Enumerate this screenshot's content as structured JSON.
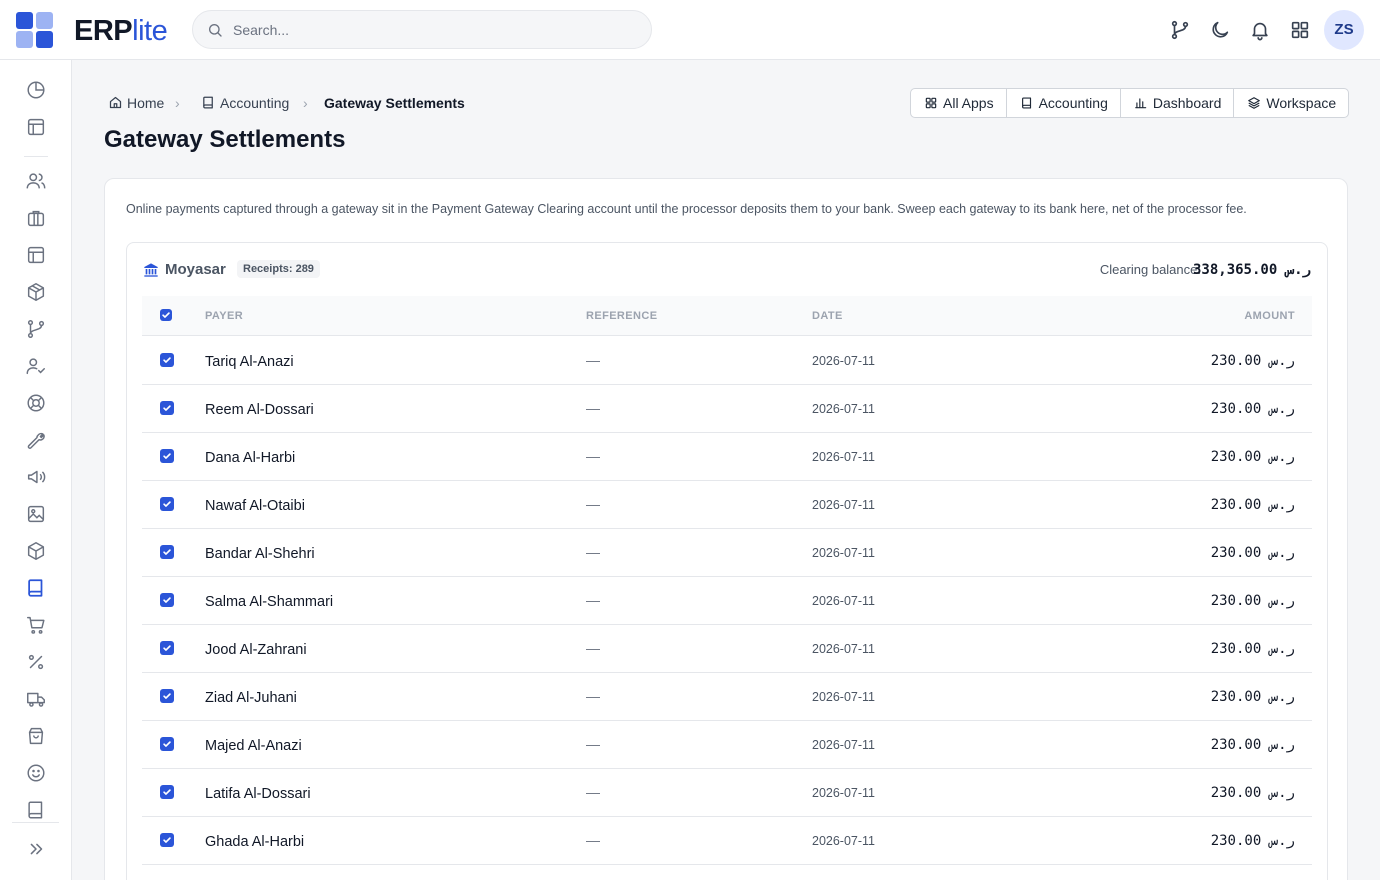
{
  "app": {
    "logo_bold": "ERP",
    "logo_light": "lite"
  },
  "search": {
    "placeholder": "Search..."
  },
  "user": {
    "initials": "ZS"
  },
  "breadcrumb": [
    {
      "label": "Home",
      "icon": "home-icon"
    },
    {
      "label": "Accounting",
      "icon": "book-icon"
    },
    {
      "label": "Gateway Settlements"
    }
  ],
  "quick_links": [
    {
      "label": "All Apps",
      "icon": "grid-icon"
    },
    {
      "label": "Accounting",
      "icon": "book-icon"
    },
    {
      "label": "Dashboard",
      "icon": "bar-chart-icon"
    },
    {
      "label": "Workspace",
      "icon": "layers-icon"
    }
  ],
  "page": {
    "title": "Gateway Settlements",
    "description": "Online payments captured through a gateway sit in the Payment Gateway Clearing account until the processor deposits them to your bank. Sweep each gateway to its bank here, net of the processor fee."
  },
  "gateway": {
    "name": "Moyasar",
    "receipts_badge": "Receipts: 289",
    "balance_label": "Clearing balance:",
    "balance_value": "338,365.00 ر.س",
    "columns": {
      "payer": "PAYER",
      "reference": "REFERENCE",
      "date": "DATE",
      "amount": "AMOUNT"
    },
    "select_all": true,
    "rows": [
      {
        "payer": "Tariq Al-Anazi",
        "reference": "—",
        "date": "2026-07-11",
        "amount": "230.00 ر.س",
        "checked": true
      },
      {
        "payer": "Reem Al-Dossari",
        "reference": "—",
        "date": "2026-07-11",
        "amount": "230.00 ر.س",
        "checked": true
      },
      {
        "payer": "Dana Al-Harbi",
        "reference": "—",
        "date": "2026-07-11",
        "amount": "230.00 ر.س",
        "checked": true
      },
      {
        "payer": "Nawaf Al-Otaibi",
        "reference": "—",
        "date": "2026-07-11",
        "amount": "230.00 ر.س",
        "checked": true
      },
      {
        "payer": "Bandar Al-Shehri",
        "reference": "—",
        "date": "2026-07-11",
        "amount": "230.00 ر.س",
        "checked": true
      },
      {
        "payer": "Salma Al-Shammari",
        "reference": "—",
        "date": "2026-07-11",
        "amount": "230.00 ر.س",
        "checked": true
      },
      {
        "payer": "Jood Al-Zahrani",
        "reference": "—",
        "date": "2026-07-11",
        "amount": "230.00 ر.س",
        "checked": true
      },
      {
        "payer": "Ziad Al-Juhani",
        "reference": "—",
        "date": "2026-07-11",
        "amount": "230.00 ر.س",
        "checked": true
      },
      {
        "payer": "Majed Al-Anazi",
        "reference": "—",
        "date": "2026-07-11",
        "amount": "230.00 ر.س",
        "checked": true
      },
      {
        "payer": "Latifa Al-Dossari",
        "reference": "—",
        "date": "2026-07-11",
        "amount": "230.00 ر.س",
        "checked": true
      },
      {
        "payer": "Ghada Al-Harbi",
        "reference": "—",
        "date": "2026-07-11",
        "amount": "230.00 ر.س",
        "checked": true
      }
    ]
  },
  "sidebar": {
    "items": [
      {
        "icon": "pie-chart-icon"
      },
      {
        "icon": "layout-icon"
      },
      {
        "icon": "users-icon"
      },
      {
        "icon": "briefcase-icon"
      },
      {
        "icon": "table-icon"
      },
      {
        "icon": "package-icon"
      },
      {
        "icon": "git-branch-icon"
      },
      {
        "icon": "user-check-icon"
      },
      {
        "icon": "life-buoy-icon"
      },
      {
        "icon": "wrench-icon"
      },
      {
        "icon": "megaphone-icon"
      },
      {
        "icon": "image-icon"
      },
      {
        "icon": "box-icon"
      },
      {
        "icon": "book-icon",
        "active": true
      },
      {
        "icon": "cart-icon"
      },
      {
        "icon": "percent-icon"
      },
      {
        "icon": "truck-icon"
      },
      {
        "icon": "shopping-bag-icon"
      },
      {
        "icon": "smile-icon"
      },
      {
        "icon": "notebook-icon"
      }
    ],
    "expand_icon": "chevrons-right-icon"
  },
  "colors": {
    "accent": "#2b55d8",
    "accent_light": "#9db3f3",
    "text": "#111827",
    "muted": "#6b7280",
    "border": "#e5e7eb"
  }
}
